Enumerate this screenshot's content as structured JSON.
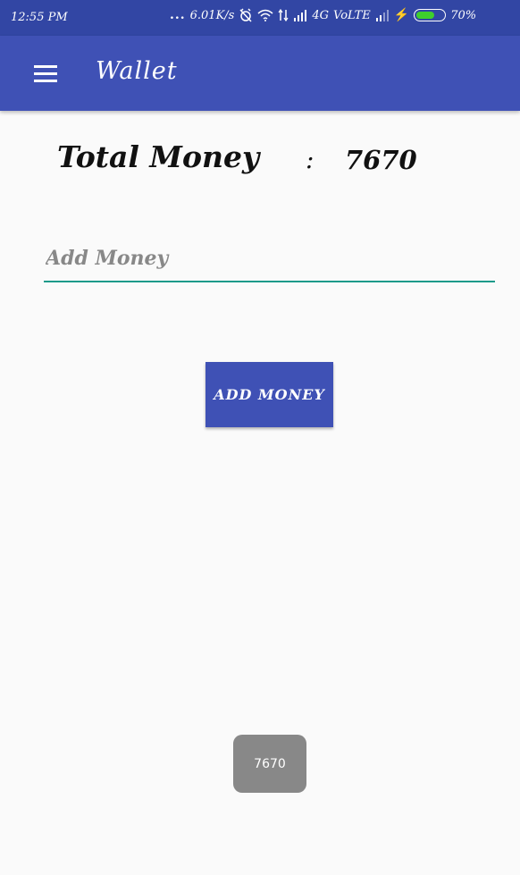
{
  "status_bar": {
    "time": "12:55 PM",
    "dots": "...",
    "speed": "6.01K/s",
    "network": "4G",
    "volte": "VoLTE",
    "battery": "70%",
    "battery_level": 0.7,
    "battery_color": "#3ecf2c"
  },
  "app_bar": {
    "title": "Wallet",
    "menu_icon": "hamburger-menu-icon",
    "color": "#3f51b5"
  },
  "wallet": {
    "total_label": "Total Money",
    "separator": ":",
    "total_value": "7670"
  },
  "add_money_input": {
    "value": "",
    "placeholder": "Add Money",
    "underline_color": "#1a9a8a"
  },
  "add_money_button": {
    "label": "ADD MONEY"
  },
  "toast": {
    "message": "7670"
  }
}
